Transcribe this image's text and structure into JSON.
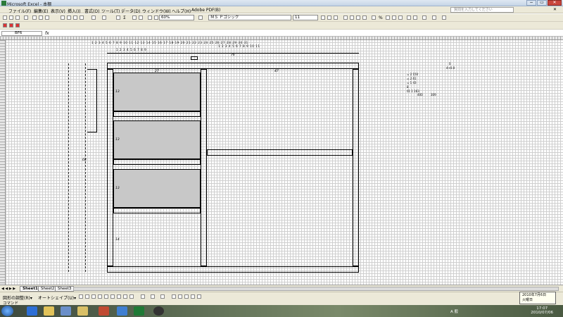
{
  "window": {
    "title": "Microsoft Excel - 本棚",
    "minimize": "−",
    "restore": "▭",
    "close": "✕"
  },
  "menu": {
    "items": [
      "ファイル(F)",
      "編集(E)",
      "表示(V)",
      "挿入(I)",
      "書式(O)",
      "ツール(T)",
      "データ(D)",
      "ウィンドウ(W)",
      "ヘルプ(H)",
      "Adobe PDF(B)"
    ],
    "help_placeholder": "質問を入力してください",
    "close": "✕"
  },
  "toolbar": {
    "zoom": "60%",
    "font_name": "ＭＳ Ｐゴシック",
    "font_size": "11",
    "sum": "Σ",
    "percent": "%"
  },
  "formula_bar": {
    "name_box": "BF6",
    "fx": "fx",
    "value": ""
  },
  "sheet": {
    "top_row_numbers": "1 2 3 4 5 6 7 8 9 10 11 12 13 14 15 16 17 18 19 20 21 22 23 24 25 26 27 28 29 30 31",
    "second_row_numbers": "1 2 3 4 5 6 7 8 9 10 11",
    "third_row_numbers": "1 2 3 4 5 6 7 8 9",
    "labels": {
      "width_total": "76",
      "left_col": "27",
      "right_col": "47",
      "shelf1": "13",
      "shelf2": "13",
      "shelf3": "13",
      "bottom": "14",
      "side": "68"
    },
    "calc": {
      "rows": [
        "= 2  150",
        "= 2   61",
        "= 1   43",
        "        8",
        "01   1  163"
      ],
      "totals": [
        "400",
        "309"
      ],
      "note": "0",
      "note2": "4+0.0"
    }
  },
  "sheet_tabs": [
    "Sheet1",
    "Sheet2",
    "Sheet3"
  ],
  "active_tab": "Sheet1",
  "drawing_toolbar": {
    "menu": "図形の調整(R)▾",
    "autoshape": "オートシェイプ(U)▾"
  },
  "status": {
    "mode": "コマンド"
  },
  "tooltip": {
    "date": "2010年7月6日",
    "weekday": "火曜日"
  },
  "taskbar": {
    "lang": "A 般",
    "time": "17:07",
    "date": "2010/07/06"
  }
}
